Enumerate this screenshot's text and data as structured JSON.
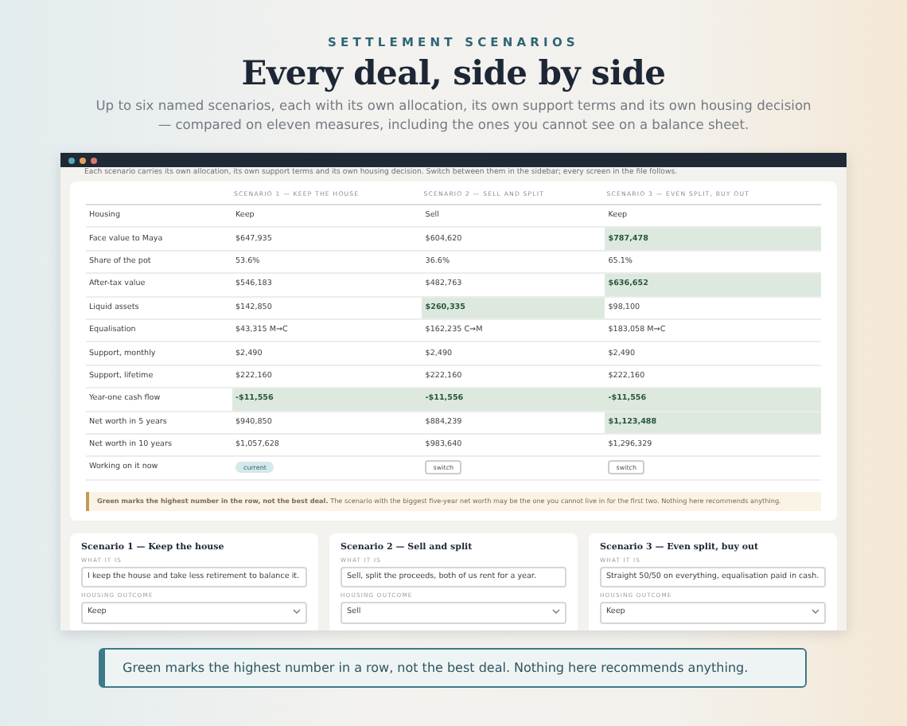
{
  "header": {
    "eyebrow": "SETTLEMENT SCENARIOS",
    "title": "Every deal, side by side",
    "subtitle": "Up to six named scenarios, each with its own allocation, its own support terms and its own housing decision — compared on eleven measures, including the ones you cannot see on a balance sheet."
  },
  "app": {
    "intro": "Each scenario carries its own allocation, its own support terms and its own housing decision. Switch between them in the sidebar; every screen in the file follows.",
    "table": {
      "columns": [
        "SCENARIO 1 — KEEP THE HOUSE",
        "SCENARIO 2 — SELL AND SPLIT",
        "SCENARIO 3 — EVEN SPLIT, BUY OUT"
      ],
      "rows": [
        {
          "label": "Housing",
          "cells": [
            {
              "text": "Keep",
              "best": false
            },
            {
              "text": "Sell",
              "best": false
            },
            {
              "text": "Keep",
              "best": false
            }
          ]
        },
        {
          "label": "Face value to Maya",
          "cells": [
            {
              "text": "$647,935",
              "best": false
            },
            {
              "text": "$604,620",
              "best": false
            },
            {
              "text": "$787,478",
              "best": true
            }
          ]
        },
        {
          "label": "Share of the pot",
          "cells": [
            {
              "text": "53.6%",
              "best": false
            },
            {
              "text": "36.6%",
              "best": false
            },
            {
              "text": "65.1%",
              "best": false
            }
          ]
        },
        {
          "label": "After-tax value",
          "cells": [
            {
              "text": "$546,183",
              "best": false
            },
            {
              "text": "$482,763",
              "best": false
            },
            {
              "text": "$636,652",
              "best": true
            }
          ]
        },
        {
          "label": "Liquid assets",
          "cells": [
            {
              "text": "$142,850",
              "best": false
            },
            {
              "text": "$260,335",
              "best": true
            },
            {
              "text": "$98,100",
              "best": false
            }
          ]
        },
        {
          "label": "Equalisation",
          "cells": [
            {
              "text": "$43,315 M→C",
              "best": false
            },
            {
              "text": "$162,235 C→M",
              "best": false
            },
            {
              "text": "$183,058 M→C",
              "best": false
            }
          ]
        },
        {
          "label": "Support, monthly",
          "cells": [
            {
              "text": "$2,490",
              "best": false
            },
            {
              "text": "$2,490",
              "best": false
            },
            {
              "text": "$2,490",
              "best": false
            }
          ]
        },
        {
          "label": "Support, lifetime",
          "cells": [
            {
              "text": "$222,160",
              "best": false
            },
            {
              "text": "$222,160",
              "best": false
            },
            {
              "text": "$222,160",
              "best": false
            }
          ]
        },
        {
          "label": "Year-one cash flow",
          "cells": [
            {
              "text": "-$11,556",
              "best": true
            },
            {
              "text": "-$11,556",
              "best": true
            },
            {
              "text": "-$11,556",
              "best": true
            }
          ]
        },
        {
          "label": "Net worth in 5 years",
          "cells": [
            {
              "text": "$940,850",
              "best": false
            },
            {
              "text": "$884,239",
              "best": false
            },
            {
              "text": "$1,123,488",
              "best": true
            }
          ]
        },
        {
          "label": "Net worth in 10 years",
          "cells": [
            {
              "text": "$1,057,628",
              "best": false
            },
            {
              "text": "$983,640",
              "best": false
            },
            {
              "text": "$1,296,329",
              "best": false
            }
          ]
        }
      ],
      "status_row": {
        "label": "Working on it now",
        "items": [
          {
            "text": "current",
            "selected": true
          },
          {
            "text": "switch",
            "selected": false
          },
          {
            "text": "switch",
            "selected": false
          }
        ]
      }
    },
    "note": {
      "bold": "Green marks the highest number in the row, not the best deal.",
      "text": "The scenario with the biggest five-year net worth may be the one you cannot live in for the first two. Nothing here recommends anything."
    },
    "cards": [
      {
        "title": "Scenario 1 — Keep the house",
        "what_label": "WHAT IT IS",
        "what": "I keep the house and take less retirement to balance it.",
        "housing_label": "HOUSING OUTCOME",
        "housing": "Keep"
      },
      {
        "title": "Scenario 2 — Sell and split",
        "what_label": "WHAT IT IS",
        "what": "Sell, split the proceeds, both of us rent for a year.",
        "housing_label": "HOUSING OUTCOME",
        "housing": "Sell"
      },
      {
        "title": "Scenario 3 — Even split, buy out",
        "what_label": "WHAT IT IS",
        "what": "Straight 50/50 on everything, equalisation paid in cash.",
        "housing_label": "HOUSING OUTCOME",
        "housing": "Keep"
      }
    ]
  },
  "callout": "Green marks the highest number in a row, not the best deal. Nothing here recommends anything."
}
